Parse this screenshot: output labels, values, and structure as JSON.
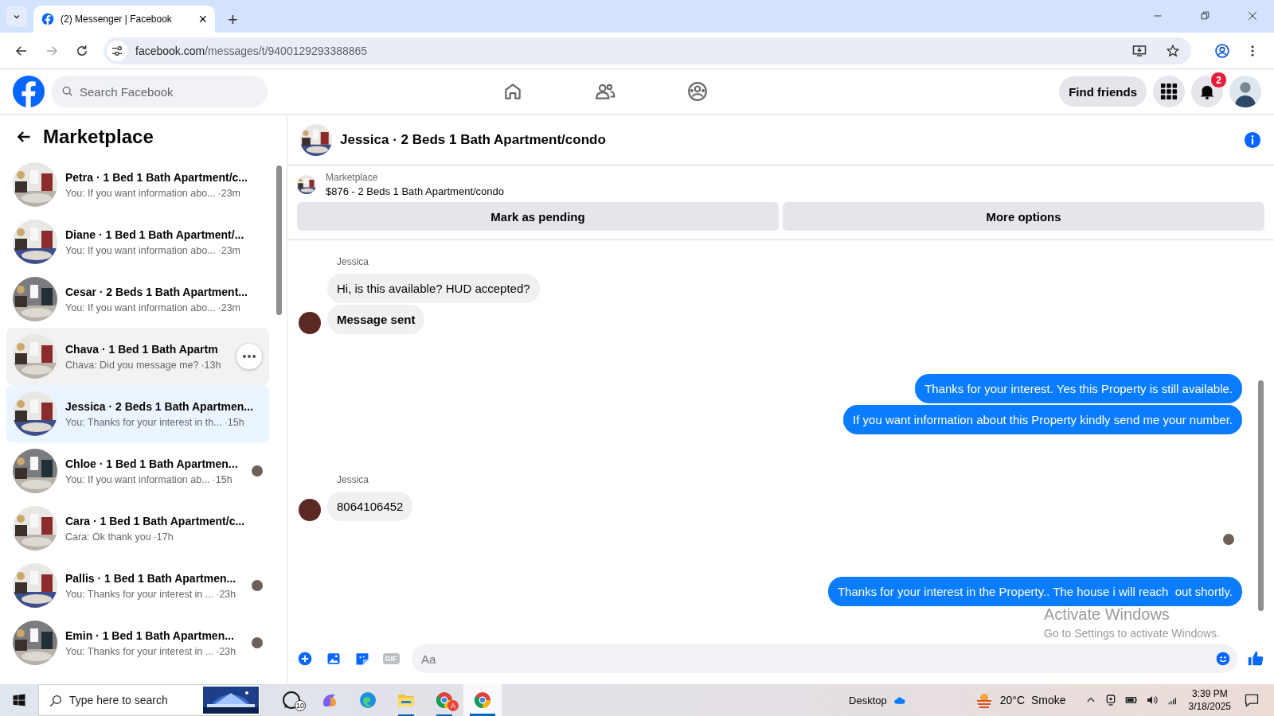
{
  "browser": {
    "tab": {
      "title": "(2) Messenger | Facebook",
      "close": "×"
    },
    "new_tab": "+",
    "url": {
      "domain": "facebook.com",
      "path": "/messages/t/9400129293388865"
    }
  },
  "header": {
    "search": {
      "placeholder": "Search Facebook"
    },
    "find_friends": "Find friends",
    "notifications": {
      "badge": "2"
    }
  },
  "sidebar": {
    "title": "Marketplace",
    "conversations": [
      {
        "title": "Petra · 1 Bed 1 Bath Apartment/c...",
        "preview": "You: If you want information abo...",
        "time": "·23m",
        "selected": false,
        "hovered": false,
        "seen": false
      },
      {
        "title": "Diane · 1 Bed 1 Bath Apartment/...",
        "preview": "You: If you want information abo...",
        "time": "·23m",
        "selected": false,
        "hovered": false,
        "seen": false
      },
      {
        "title": "Cesar · 2 Beds 1 Bath Apartment...",
        "preview": "You: If you want information abo...",
        "time": "·23m",
        "selected": false,
        "hovered": false,
        "seen": false
      },
      {
        "title": "Chava · 1 Bed 1 Bath Apartm",
        "preview": "Chava: Did you message me?",
        "time": "·13h",
        "selected": false,
        "hovered": true,
        "seen": false
      },
      {
        "title": "Jessica · 2 Beds 1 Bath Apartmen...",
        "preview": "You: Thanks for your interest in th...",
        "time": "·15h",
        "selected": true,
        "hovered": false,
        "seen": false
      },
      {
        "title": "Chloe · 1 Bed 1 Bath Apartmen...",
        "preview": "You: If you want information ab...",
        "time": "·15h",
        "selected": false,
        "hovered": false,
        "seen": true
      },
      {
        "title": "Cara · 1 Bed 1 Bath Apartment/c...",
        "preview": "Cara: Ok thank you",
        "time": "·17h",
        "selected": false,
        "hovered": false,
        "seen": false
      },
      {
        "title": "Pallis · 1 Bed 1 Bath Apartmen...",
        "preview": "You: Thanks for your interest in ...",
        "time": "·23h",
        "selected": false,
        "hovered": false,
        "seen": true
      },
      {
        "title": "Emin · 1 Bed 1 Bath Apartmen...",
        "preview": "You: Thanks for your interest in ...",
        "time": "·23h",
        "selected": false,
        "hovered": false,
        "seen": true
      }
    ]
  },
  "chat": {
    "title": "Jessica · 2 Beds 1 Bath Apartment/condo",
    "listing": {
      "label": "Marketplace",
      "title": "$876 - 2 Beds 1 Bath Apartment/condo"
    },
    "actions": [
      "Mark as pending",
      "More options"
    ],
    "groups": [
      {
        "kind": "incoming",
        "sender": "Jessica",
        "seen": false,
        "messages": [
          {
            "text": "Hi, is this available? HUD accepted?",
            "bold": false
          },
          {
            "text": "Message sent",
            "bold": true
          }
        ]
      },
      {
        "kind": "outgoing",
        "seen": false,
        "messages": [
          {
            "text": "Thanks for your interest. Yes this Property is still available.",
            "bold": false
          },
          {
            "text": "If you want information about this Property kindly send me your number.",
            "bold": false
          }
        ]
      },
      {
        "kind": "incoming",
        "sender": "Jessica",
        "seen": true,
        "messages": [
          {
            "text": "8064106452",
            "bold": false
          }
        ]
      },
      {
        "kind": "outgoing",
        "seen": false,
        "messages": [
          {
            "text": "Thanks for your interest in the Property.. The house i will reach  out shortly.",
            "bold": false
          }
        ]
      }
    ]
  },
  "composer": {
    "placeholder": "Aa",
    "gif": "GIF"
  },
  "watermark": {
    "title": "Activate Windows",
    "subtitle": "Go to Settings to activate Windows."
  },
  "taskbar": {
    "search": {
      "placeholder": "Type here to search"
    },
    "apps": [
      {
        "kind": "whatsapp",
        "badge": "10",
        "running": false,
        "selected": false
      },
      {
        "kind": "copilot",
        "running": false,
        "selected": false
      },
      {
        "kind": "edge",
        "running": false,
        "selected": false
      },
      {
        "kind": "explorer",
        "running": true,
        "selected": false
      },
      {
        "kind": "chrome",
        "badge": "A",
        "running": true,
        "selected": false
      },
      {
        "kind": "chrome",
        "running": true,
        "selected": true
      }
    ],
    "desktop": "Desktop",
    "weather": {
      "temp": "20°C",
      "condition": "Smoke"
    },
    "clock": {
      "time": "3:39 PM",
      "date": "3/18/2025"
    }
  }
}
